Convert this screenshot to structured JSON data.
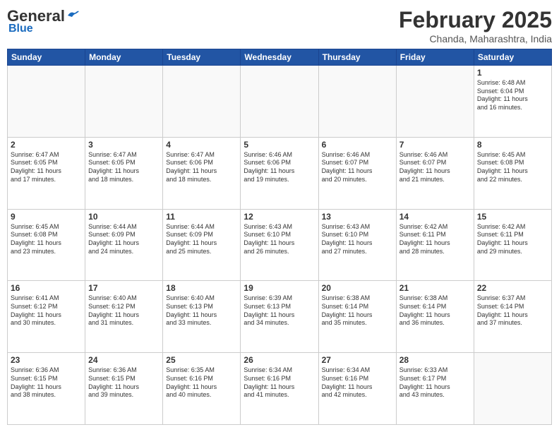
{
  "logo": {
    "general": "General",
    "blue": "Blue"
  },
  "title": {
    "month_year": "February 2025",
    "location": "Chanda, Maharashtra, India"
  },
  "days_of_week": [
    "Sunday",
    "Monday",
    "Tuesday",
    "Wednesday",
    "Thursday",
    "Friday",
    "Saturday"
  ],
  "weeks": [
    [
      {
        "day": "",
        "info": ""
      },
      {
        "day": "",
        "info": ""
      },
      {
        "day": "",
        "info": ""
      },
      {
        "day": "",
        "info": ""
      },
      {
        "day": "",
        "info": ""
      },
      {
        "day": "",
        "info": ""
      },
      {
        "day": "1",
        "info": "Sunrise: 6:48 AM\nSunset: 6:04 PM\nDaylight: 11 hours\nand 16 minutes."
      }
    ],
    [
      {
        "day": "2",
        "info": "Sunrise: 6:47 AM\nSunset: 6:05 PM\nDaylight: 11 hours\nand 17 minutes."
      },
      {
        "day": "3",
        "info": "Sunrise: 6:47 AM\nSunset: 6:05 PM\nDaylight: 11 hours\nand 18 minutes."
      },
      {
        "day": "4",
        "info": "Sunrise: 6:47 AM\nSunset: 6:06 PM\nDaylight: 11 hours\nand 18 minutes."
      },
      {
        "day": "5",
        "info": "Sunrise: 6:46 AM\nSunset: 6:06 PM\nDaylight: 11 hours\nand 19 minutes."
      },
      {
        "day": "6",
        "info": "Sunrise: 6:46 AM\nSunset: 6:07 PM\nDaylight: 11 hours\nand 20 minutes."
      },
      {
        "day": "7",
        "info": "Sunrise: 6:46 AM\nSunset: 6:07 PM\nDaylight: 11 hours\nand 21 minutes."
      },
      {
        "day": "8",
        "info": "Sunrise: 6:45 AM\nSunset: 6:08 PM\nDaylight: 11 hours\nand 22 minutes."
      }
    ],
    [
      {
        "day": "9",
        "info": "Sunrise: 6:45 AM\nSunset: 6:08 PM\nDaylight: 11 hours\nand 23 minutes."
      },
      {
        "day": "10",
        "info": "Sunrise: 6:44 AM\nSunset: 6:09 PM\nDaylight: 11 hours\nand 24 minutes."
      },
      {
        "day": "11",
        "info": "Sunrise: 6:44 AM\nSunset: 6:09 PM\nDaylight: 11 hours\nand 25 minutes."
      },
      {
        "day": "12",
        "info": "Sunrise: 6:43 AM\nSunset: 6:10 PM\nDaylight: 11 hours\nand 26 minutes."
      },
      {
        "day": "13",
        "info": "Sunrise: 6:43 AM\nSunset: 6:10 PM\nDaylight: 11 hours\nand 27 minutes."
      },
      {
        "day": "14",
        "info": "Sunrise: 6:42 AM\nSunset: 6:11 PM\nDaylight: 11 hours\nand 28 minutes."
      },
      {
        "day": "15",
        "info": "Sunrise: 6:42 AM\nSunset: 6:11 PM\nDaylight: 11 hours\nand 29 minutes."
      }
    ],
    [
      {
        "day": "16",
        "info": "Sunrise: 6:41 AM\nSunset: 6:12 PM\nDaylight: 11 hours\nand 30 minutes."
      },
      {
        "day": "17",
        "info": "Sunrise: 6:40 AM\nSunset: 6:12 PM\nDaylight: 11 hours\nand 31 minutes."
      },
      {
        "day": "18",
        "info": "Sunrise: 6:40 AM\nSunset: 6:13 PM\nDaylight: 11 hours\nand 33 minutes."
      },
      {
        "day": "19",
        "info": "Sunrise: 6:39 AM\nSunset: 6:13 PM\nDaylight: 11 hours\nand 34 minutes."
      },
      {
        "day": "20",
        "info": "Sunrise: 6:38 AM\nSunset: 6:14 PM\nDaylight: 11 hours\nand 35 minutes."
      },
      {
        "day": "21",
        "info": "Sunrise: 6:38 AM\nSunset: 6:14 PM\nDaylight: 11 hours\nand 36 minutes."
      },
      {
        "day": "22",
        "info": "Sunrise: 6:37 AM\nSunset: 6:14 PM\nDaylight: 11 hours\nand 37 minutes."
      }
    ],
    [
      {
        "day": "23",
        "info": "Sunrise: 6:36 AM\nSunset: 6:15 PM\nDaylight: 11 hours\nand 38 minutes."
      },
      {
        "day": "24",
        "info": "Sunrise: 6:36 AM\nSunset: 6:15 PM\nDaylight: 11 hours\nand 39 minutes."
      },
      {
        "day": "25",
        "info": "Sunrise: 6:35 AM\nSunset: 6:16 PM\nDaylight: 11 hours\nand 40 minutes."
      },
      {
        "day": "26",
        "info": "Sunrise: 6:34 AM\nSunset: 6:16 PM\nDaylight: 11 hours\nand 41 minutes."
      },
      {
        "day": "27",
        "info": "Sunrise: 6:34 AM\nSunset: 6:16 PM\nDaylight: 11 hours\nand 42 minutes."
      },
      {
        "day": "28",
        "info": "Sunrise: 6:33 AM\nSunset: 6:17 PM\nDaylight: 11 hours\nand 43 minutes."
      },
      {
        "day": "",
        "info": ""
      }
    ]
  ]
}
